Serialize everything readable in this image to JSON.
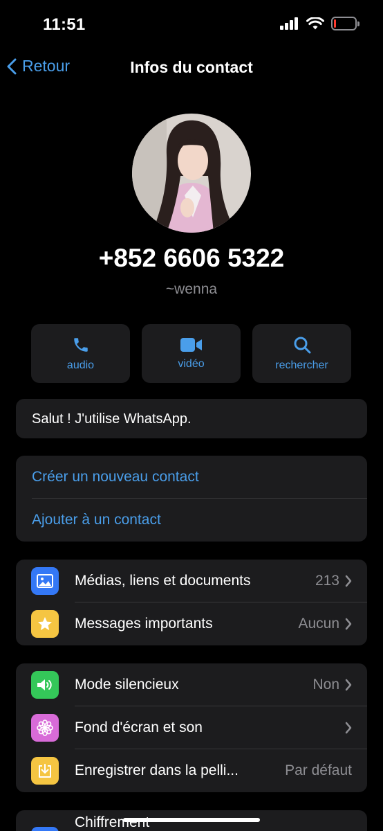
{
  "status": {
    "time": "11:51",
    "battery_level": 0.1
  },
  "nav": {
    "back_label": "Retour",
    "title": "Infos du contact"
  },
  "contact": {
    "phone": "+852 6606 5322",
    "username": "~wenna"
  },
  "actions": [
    {
      "label": "audio",
      "icon": "phone-icon"
    },
    {
      "label": "vidéo",
      "icon": "video-icon"
    },
    {
      "label": "rechercher",
      "icon": "search-icon"
    }
  ],
  "about": "Salut ! J'utilise WhatsApp.",
  "contact_links": [
    "Créer un nouveau contact",
    "Ajouter à un contact"
  ],
  "media_section": [
    {
      "label": "Médias, liens et documents",
      "value": "213",
      "icon": "photo-icon",
      "color": "#3478f6"
    },
    {
      "label": "Messages importants",
      "value": "Aucun",
      "icon": "star-icon",
      "color": "#f5c542"
    }
  ],
  "settings_section": [
    {
      "label": "Mode silencieux",
      "value": "Non",
      "icon": "speaker-icon",
      "color": "#34c759"
    },
    {
      "label": "Fond d'écran et son",
      "value": "",
      "icon": "flower-icon",
      "color": "#d86bd8"
    },
    {
      "label": "Enregistrer dans la pelli...",
      "value": "Par défaut",
      "icon": "download-icon",
      "color": "#f5c542"
    }
  ],
  "encryption": {
    "label": "Chiffrement"
  }
}
